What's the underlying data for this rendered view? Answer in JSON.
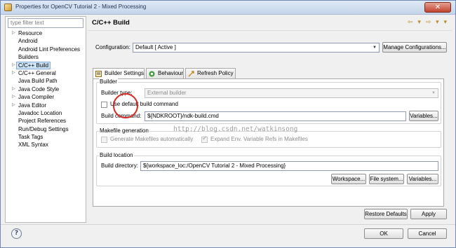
{
  "window": {
    "title": "Properties for OpenCV Tutorial 2 - Mixed Processing",
    "close_label": "✕"
  },
  "filter": {
    "placeholder": "type filter text"
  },
  "tree": [
    {
      "label": "Resource",
      "arrow": "▷"
    },
    {
      "label": "Android",
      "arrow": ""
    },
    {
      "label": "Android Lint Preferences",
      "arrow": ""
    },
    {
      "label": "Builders",
      "arrow": ""
    },
    {
      "label": "C/C++ Build",
      "arrow": "▷",
      "selected": true
    },
    {
      "label": "C/C++ General",
      "arrow": "▷"
    },
    {
      "label": "Java Build Path",
      "arrow": ""
    },
    {
      "label": "Java Code Style",
      "arrow": "▷"
    },
    {
      "label": "Java Compiler",
      "arrow": "▷"
    },
    {
      "label": "Java Editor",
      "arrow": "▷"
    },
    {
      "label": "Javadoc Location",
      "arrow": ""
    },
    {
      "label": "Project References",
      "arrow": ""
    },
    {
      "label": "Run/Debug Settings",
      "arrow": ""
    },
    {
      "label": "Task Tags",
      "arrow": ""
    },
    {
      "label": "XML Syntax",
      "arrow": ""
    }
  ],
  "page": {
    "title": "C/C++ Build",
    "nav_arrows": "⇦ ▾ ⇨ ▾ ▾",
    "configuration_label": "Configuration:",
    "configuration_value": "Default  [ Active ]",
    "manage_button": "Manage Configurations...",
    "tabs": [
      "Builder Settings",
      "Behaviour",
      "Refresh Policy"
    ],
    "builder_group": "Builder",
    "builder_type_label": "Builder type:",
    "builder_type_value": "External builder",
    "use_default_label": "Use default build command",
    "build_command_label": "Build command:",
    "build_command_value": "${NDKROOT}/ndk-build.cmd",
    "variables_button": "Variables...",
    "makefile_group": "Makefile generation",
    "generate_label": "Generate Makefiles automatically",
    "expand_label": "Expand Env. Variable Refs in Makefiles",
    "location_group": "Build location",
    "build_directory_label": "Build directory:",
    "build_directory_value": "${workspace_loc:/OpenCV Tutorial 2 - Mixed Processing}",
    "workspace_button": "Workspace...",
    "filesystem_button": "File system...",
    "variables_button2": "Variables...",
    "restore_button": "Restore Defaults",
    "apply_button": "Apply"
  },
  "watermark": "http://blog.csdn.net/watkinsong",
  "footer": {
    "help": "?",
    "ok_button": "OK",
    "cancel_button": "Cancel"
  },
  "colors": {
    "selection": "#cde4f7",
    "annotation_circle": "#d42a23"
  }
}
